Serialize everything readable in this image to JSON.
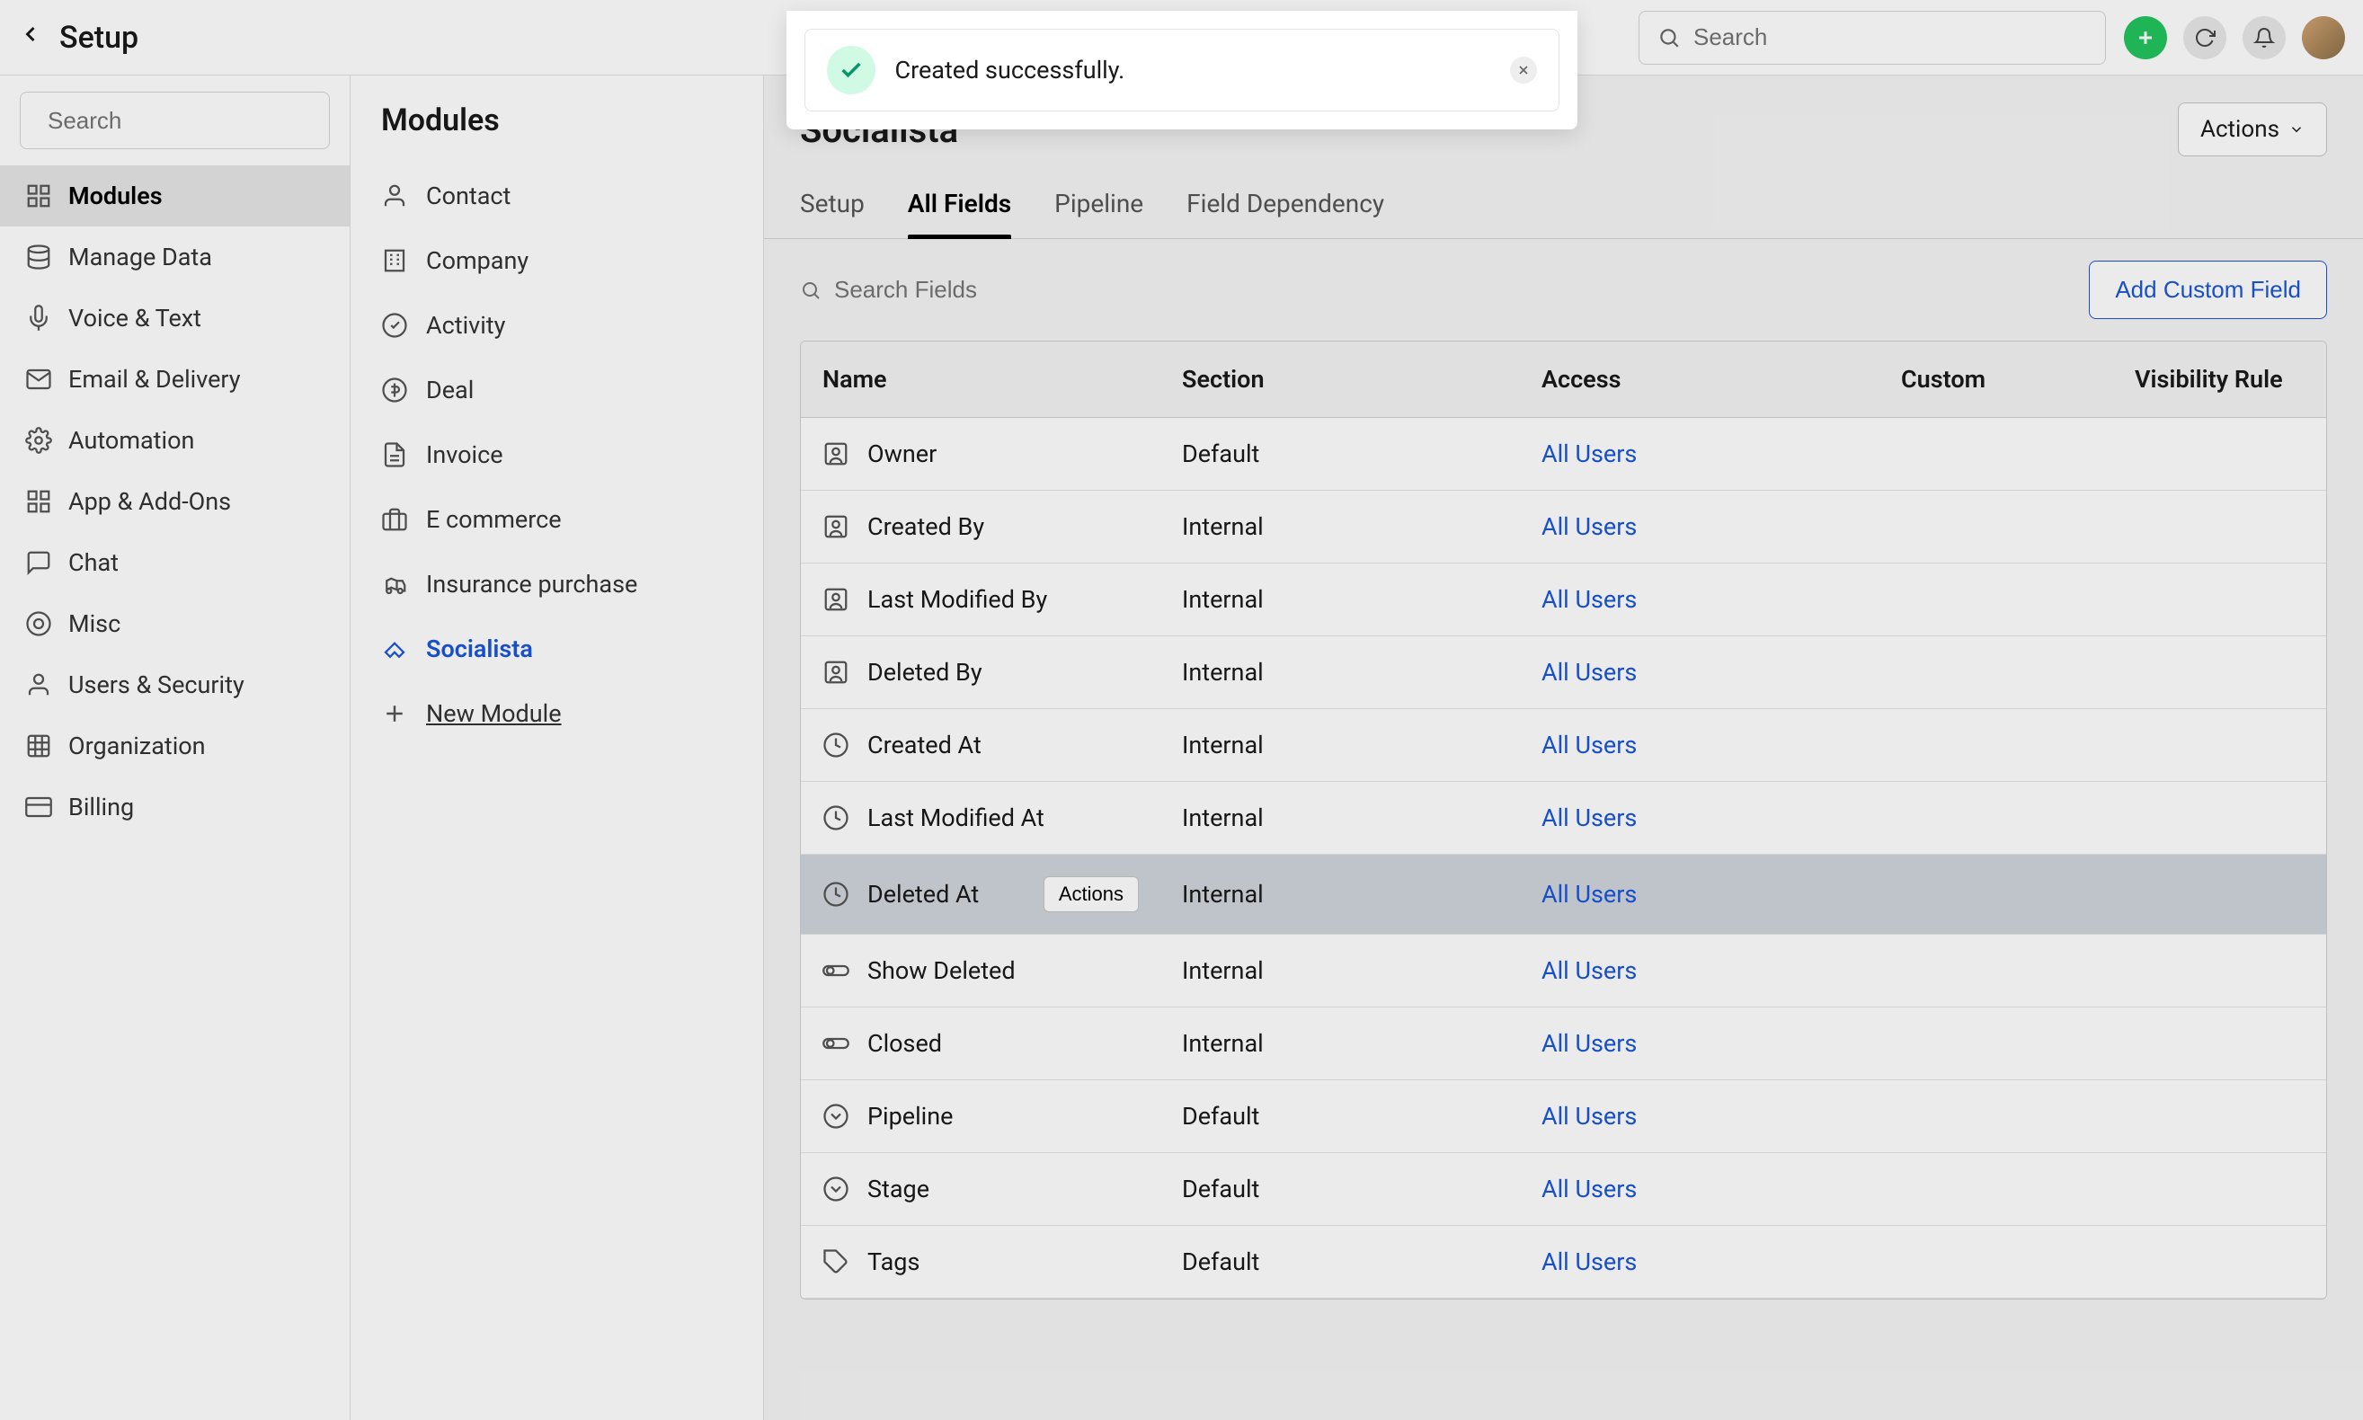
{
  "header": {
    "title": "Setup",
    "search_placeholder": "Search"
  },
  "sidebar": {
    "search_placeholder": "Search",
    "items": [
      {
        "label": "Modules",
        "icon": "modules"
      },
      {
        "label": "Manage Data",
        "icon": "manage-data"
      },
      {
        "label": "Voice & Text",
        "icon": "voice-text"
      },
      {
        "label": "Email & Delivery",
        "icon": "email"
      },
      {
        "label": "Automation",
        "icon": "automation"
      },
      {
        "label": "App & Add-Ons",
        "icon": "apps"
      },
      {
        "label": "Chat",
        "icon": "chat"
      },
      {
        "label": "Misc",
        "icon": "misc"
      },
      {
        "label": "Users & Security",
        "icon": "users"
      },
      {
        "label": "Organization",
        "icon": "org"
      },
      {
        "label": "Billing",
        "icon": "billing"
      }
    ],
    "active_index": 0
  },
  "module_col": {
    "title": "Modules",
    "items": [
      {
        "label": "Contact",
        "icon": "contact"
      },
      {
        "label": "Company",
        "icon": "company"
      },
      {
        "label": "Activity",
        "icon": "activity"
      },
      {
        "label": "Deal",
        "icon": "deal"
      },
      {
        "label": "Invoice",
        "icon": "invoice"
      },
      {
        "label": "E commerce",
        "icon": "ecommerce"
      },
      {
        "label": "Insurance purchase",
        "icon": "insurance"
      },
      {
        "label": "Socialista",
        "icon": "socialista"
      }
    ],
    "new_module_label": "New Module",
    "active_index": 7
  },
  "content": {
    "title": "Socialista",
    "actions_label": "Actions",
    "tabs": [
      {
        "label": "Setup"
      },
      {
        "label": "All Fields"
      },
      {
        "label": "Pipeline"
      },
      {
        "label": "Field Dependency"
      }
    ],
    "active_tab": 1,
    "search_fields_placeholder": "Search Fields",
    "add_field_label": "Add Custom Field",
    "row_actions_label": "Actions",
    "columns": [
      "Name",
      "Section",
      "Access",
      "Custom",
      "Visibility Rule"
    ],
    "rows": [
      {
        "icon": "person-box",
        "name": "Owner",
        "section": "Default",
        "access": "All Users"
      },
      {
        "icon": "person-box",
        "name": "Created By",
        "section": "Internal",
        "access": "All Users"
      },
      {
        "icon": "person-box",
        "name": "Last Modified By",
        "section": "Internal",
        "access": "All Users"
      },
      {
        "icon": "person-box",
        "name": "Deleted By",
        "section": "Internal",
        "access": "All Users"
      },
      {
        "icon": "clock",
        "name": "Created At",
        "section": "Internal",
        "access": "All Users"
      },
      {
        "icon": "clock",
        "name": "Last Modified At",
        "section": "Internal",
        "access": "All Users"
      },
      {
        "icon": "clock",
        "name": "Deleted At",
        "section": "Internal",
        "access": "All Users",
        "highlight": true,
        "show_actions": true
      },
      {
        "icon": "toggle",
        "name": "Show Deleted",
        "section": "Internal",
        "access": "All Users"
      },
      {
        "icon": "toggle",
        "name": "Closed",
        "section": "Internal",
        "access": "All Users"
      },
      {
        "icon": "dropdown",
        "name": "Pipeline",
        "section": "Default",
        "access": "All Users"
      },
      {
        "icon": "dropdown",
        "name": "Stage",
        "section": "Default",
        "access": "All Users"
      },
      {
        "icon": "tag",
        "name": "Tags",
        "section": "Default",
        "access": "All Users"
      }
    ]
  },
  "toast": {
    "message": "Created successfully."
  }
}
